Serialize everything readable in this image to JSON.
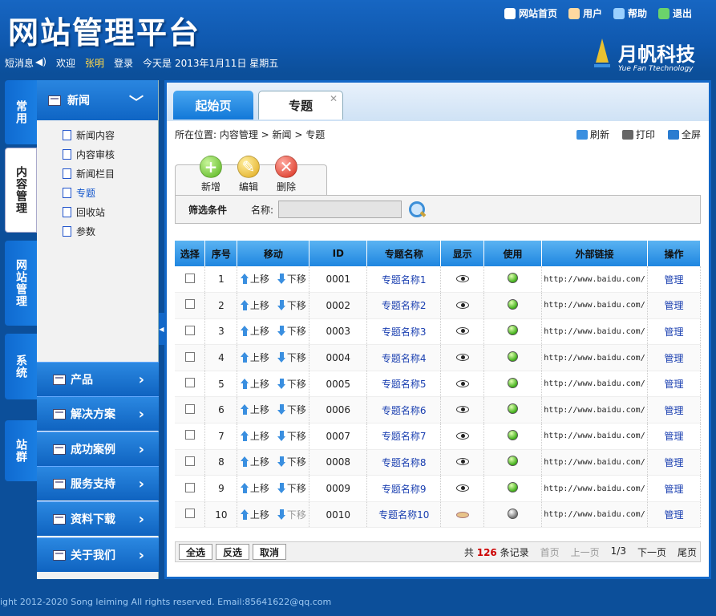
{
  "app": {
    "title": "网站管理平台"
  },
  "topnav": [
    {
      "label": "网站首页",
      "icon": "home-icon",
      "color": "#ffffff"
    },
    {
      "label": "用户",
      "icon": "user-icon",
      "color": "#ffd9a0"
    },
    {
      "label": "帮助",
      "icon": "help-icon",
      "color": "#9ad0ff"
    },
    {
      "label": "退出",
      "icon": "exit-icon",
      "color": "#6bd36b"
    }
  ],
  "subbar": {
    "messages": "短消息",
    "welcome": "欢迎",
    "user": "张明",
    "login": "登录",
    "today": "今天是",
    "date": "2013年1月11日 星期五"
  },
  "brand": {
    "name": "月帆科技",
    "sub": "Yue Fan Ttechnology"
  },
  "vtabs": [
    "常用",
    "内容管理",
    "网站管理",
    "系统",
    "站群"
  ],
  "sidebar": {
    "header": "新闻",
    "items": [
      "新闻内容",
      "内容审核",
      "新闻栏目",
      "专题",
      "回收站",
      "参数"
    ],
    "sections": [
      "产品",
      "解决方案",
      "成功案例",
      "服务支持",
      "资料下载",
      "关于我们"
    ]
  },
  "tabs": {
    "home": "起始页",
    "current": "专题"
  },
  "breadcrumb": "所在位置: 内容管理 > 新闻 > 专题",
  "tools": {
    "refresh": "刷新",
    "print": "打印",
    "fullscreen": "全屏"
  },
  "actions": {
    "add": "新增",
    "edit": "编辑",
    "delete": "删除"
  },
  "filter": {
    "title": "筛选条件",
    "name_label": "名称:",
    "name_value": ""
  },
  "table": {
    "headers": [
      "选择",
      "序号",
      "移动",
      "ID",
      "专题名称",
      "显示",
      "使用",
      "外部链接",
      "操作"
    ],
    "up": "上移",
    "down": "下移",
    "rows": [
      {
        "no": "1",
        "id": "0001",
        "name": "专题名称1",
        "url": "http://www.baidu.com/",
        "op": "管理",
        "shown": true,
        "used": true,
        "down_enabled": true
      },
      {
        "no": "2",
        "id": "0002",
        "name": "专题名称2",
        "url": "http://www.baidu.com/",
        "op": "管理",
        "shown": true,
        "used": true,
        "down_enabled": true
      },
      {
        "no": "3",
        "id": "0003",
        "name": "专题名称3",
        "url": "http://www.baidu.com/",
        "op": "管理",
        "shown": true,
        "used": true,
        "down_enabled": true
      },
      {
        "no": "4",
        "id": "0004",
        "name": "专题名称4",
        "url": "http://www.baidu.com/",
        "op": "管理",
        "shown": true,
        "used": true,
        "down_enabled": true
      },
      {
        "no": "5",
        "id": "0005",
        "name": "专题名称5",
        "url": "http://www.baidu.com/",
        "op": "管理",
        "shown": true,
        "used": true,
        "down_enabled": true
      },
      {
        "no": "6",
        "id": "0006",
        "name": "专题名称6",
        "url": "http://www.baidu.com/",
        "op": "管理",
        "shown": true,
        "used": true,
        "down_enabled": true
      },
      {
        "no": "7",
        "id": "0007",
        "name": "专题名称7",
        "url": "http://www.baidu.com/",
        "op": "管理",
        "shown": true,
        "used": true,
        "down_enabled": true
      },
      {
        "no": "8",
        "id": "0008",
        "name": "专题名称8",
        "url": "http://www.baidu.com/",
        "op": "管理",
        "shown": true,
        "used": true,
        "down_enabled": true
      },
      {
        "no": "9",
        "id": "0009",
        "name": "专题名称9",
        "url": "http://www.baidu.com/",
        "op": "管理",
        "shown": true,
        "used": true,
        "down_enabled": true
      },
      {
        "no": "10",
        "id": "0010",
        "name": "专题名称10",
        "url": "http://www.baidu.com/",
        "op": "管理",
        "shown": false,
        "used": false,
        "down_enabled": false
      }
    ]
  },
  "footer": {
    "select_all": "全选",
    "invert": "反选",
    "cancel": "取消",
    "total_prefix": "共",
    "total": "126",
    "total_suffix": "条记录",
    "first": "首页",
    "prev": "上一页",
    "page": "1/3",
    "next": "下一页",
    "last": "尾页"
  },
  "copyright": "ight 2012-2020 Song leiming All rights reserved.   Email:85641622@qq.com"
}
